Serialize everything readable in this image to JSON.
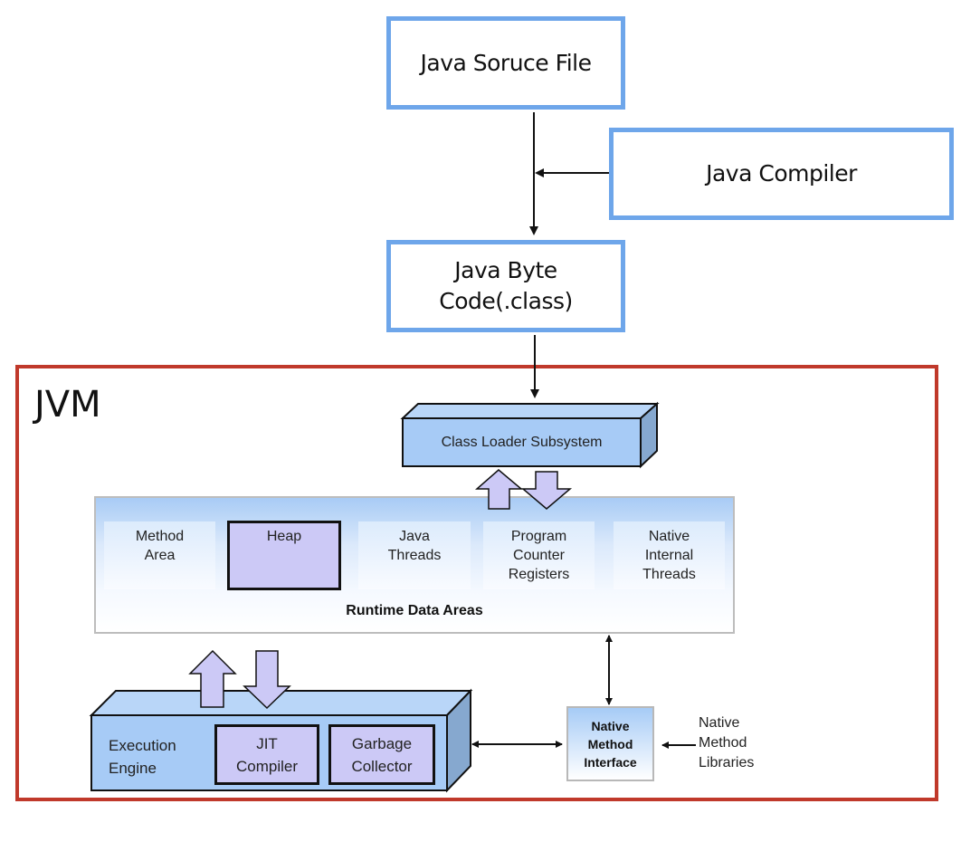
{
  "source_file": {
    "label": "Java Soruce File"
  },
  "compiler": {
    "label": "Java Compiler"
  },
  "byte_code": {
    "line1": "Java Byte",
    "line2": "Code(.class)"
  },
  "jvm": {
    "title": "JVM",
    "class_loader": {
      "label": "Class Loader Subsystem"
    },
    "runtime_data_areas": {
      "label": "Runtime Data Areas",
      "areas": [
        {
          "lines": [
            "Method",
            "Area"
          ]
        },
        {
          "lines": [
            "Heap"
          ]
        },
        {
          "lines": [
            "Java",
            "Threads"
          ]
        },
        {
          "lines": [
            "Program",
            "Counter",
            "Registers"
          ]
        },
        {
          "lines": [
            "Native",
            "Internal",
            "Threads"
          ]
        }
      ]
    },
    "execution_engine": {
      "lines": [
        "Execution",
        "Engine"
      ],
      "jit": {
        "lines": [
          "JIT",
          "Compiler"
        ]
      },
      "gc": {
        "lines": [
          "Garbage",
          "Collector"
        ]
      }
    },
    "native_method_interface": {
      "lines": [
        "Native",
        "Method",
        "Interface"
      ]
    },
    "native_method_libraries": {
      "lines": [
        "Native",
        "Method",
        "Libraries"
      ]
    }
  },
  "colors": {
    "flow_box_border": "#6ea6ea",
    "jvm_border": "#c0392b",
    "component_blue": "#a7cbf6",
    "component_purple": "#ccc9f6"
  }
}
